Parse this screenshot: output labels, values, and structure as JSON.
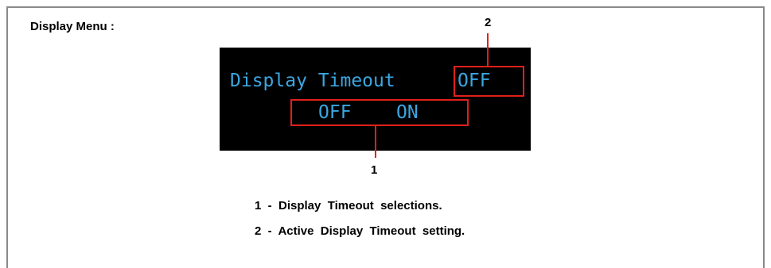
{
  "title": "Display Menu :",
  "lcd": {
    "label": "Display Timeout",
    "active_value": "OFF",
    "options": [
      "OFF",
      "ON"
    ]
  },
  "callouts": {
    "one": "1",
    "two": "2"
  },
  "legend": {
    "item1": "1  -  Display  Timeout  selections.",
    "item2": "2  -  Active  Display  Timeout  setting."
  },
  "colors": {
    "lcd_background": "#000000",
    "lcd_text": "#3aa6e0",
    "callout": "#e0201a",
    "frame_border": "#8a8a8a"
  }
}
